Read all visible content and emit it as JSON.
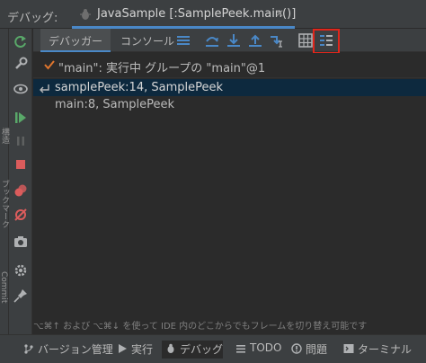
{
  "window": {
    "title_label": "デバッグ:",
    "session_title": "JavaSample [:SamplePeek.main()]",
    "close_glyph": "✕"
  },
  "toolbar": {
    "tabs": [
      {
        "label": "デバッガー",
        "selected": true
      },
      {
        "label": "コンソール",
        "selected": false
      }
    ],
    "highlight_color": "#e0261b"
  },
  "thread": {
    "label": "\"main\": 実行中 グループの \"main\"@1"
  },
  "frames": [
    {
      "label": "samplePeek:14, SamplePeek",
      "selected": true
    },
    {
      "label": "main:8, SamplePeek",
      "selected": false
    }
  ],
  "hint": "⌥⌘↑ および ⌥⌘↓ を使って IDE 内のどこからでもフレームを切り替え可能です",
  "bottom_bar": {
    "items": [
      {
        "label": "バージョン管理",
        "icon": "version-control-icon"
      },
      {
        "label": "実行",
        "icon": "run-icon"
      },
      {
        "label": "デバッグ",
        "icon": "debug-icon",
        "active": true
      },
      {
        "label": "TODO",
        "icon": "todo-icon"
      },
      {
        "label": "問題",
        "icon": "problems-icon"
      },
      {
        "label": "ターミナル",
        "icon": "terminal-icon"
      }
    ]
  },
  "side_tabs": [
    "構造",
    "ブックマーク",
    "Commit"
  ],
  "colors": {
    "accent": "#4a88c7",
    "selected_row": "#0d293e",
    "resume_green": "#59a869",
    "stop_red": "#db5c5c",
    "checkmark": "#e0762d"
  }
}
